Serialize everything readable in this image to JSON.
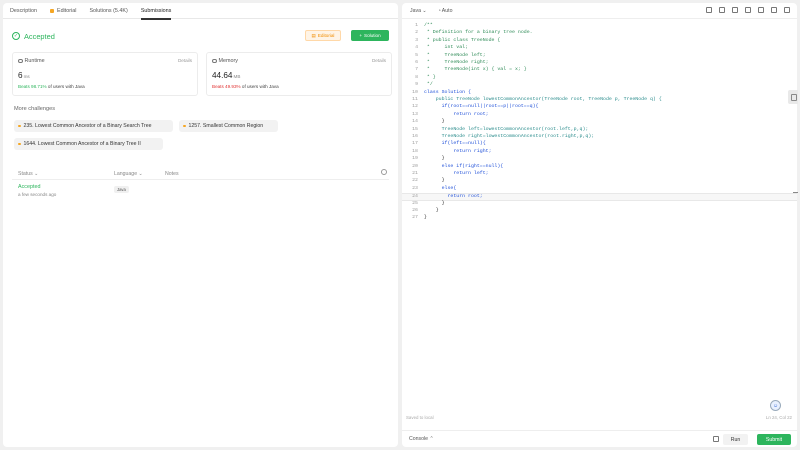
{
  "tabs": [
    {
      "label": "Description"
    },
    {
      "label": "Editorial"
    },
    {
      "label": "Solutions (5.4K)"
    },
    {
      "label": "Submissions"
    }
  ],
  "result": {
    "status": "Accepted",
    "editorial_btn": "Editorial",
    "solution_btn": "Solution"
  },
  "runtime": {
    "label": "Runtime",
    "details": "Details",
    "value": "6",
    "unit": "ms",
    "beats_pct": "Beats 98.71%",
    "beats_suffix": "of users with Java"
  },
  "memory": {
    "label": "Memory",
    "details": "Details",
    "value": "44.64",
    "unit": "MB",
    "beats_pct": "Beats 49.93%",
    "beats_suffix": "of users with Java"
  },
  "more": {
    "title": "More challenges",
    "items": [
      {
        "label": "235. Lowest Common Ancestor of a Binary Search Tree"
      },
      {
        "label": "1257. Smallest Common Region"
      },
      {
        "label": "1644. Lowest Common Ancestor of a Binary Tree II"
      }
    ]
  },
  "submissions": {
    "col_status": "Status",
    "col_language": "Language",
    "col_notes": "Notes",
    "row": {
      "status": "Accepted",
      "time": "a few seconds ago",
      "language": "Java"
    }
  },
  "editor": {
    "language": "Java",
    "mode": "Auto",
    "saved": "Saved to local",
    "cursor": "Ln 24, Col 22",
    "console": "Console",
    "run": "Run",
    "submit": "Submit",
    "lines": [
      {
        "n": "1",
        "text": "/**",
        "cls": "c-comment"
      },
      {
        "n": "2",
        "text": " * Definition for a binary tree node.",
        "cls": "c-comment"
      },
      {
        "n": "3",
        "text": " * public class TreeNode {",
        "cls": "c-comment"
      },
      {
        "n": "4",
        "text": " *     int val;",
        "cls": "c-comment"
      },
      {
        "n": "5",
        "text": " *     TreeNode left;",
        "cls": "c-comment"
      },
      {
        "n": "6",
        "text": " *     TreeNode right;",
        "cls": "c-comment"
      },
      {
        "n": "7",
        "text": " *     TreeNode(int x) { val = x; }",
        "cls": "c-comment"
      },
      {
        "n": "8",
        "text": " * }",
        "cls": "c-comment"
      },
      {
        "n": "9",
        "text": " */",
        "cls": "c-comment"
      },
      {
        "n": "10",
        "text": "class Solution {",
        "cls": "c-kw"
      },
      {
        "n": "11",
        "text": "    public TreeNode lowestCommonAncestor(TreeNode root, TreeNode p, TreeNode q) {",
        "cls": "c-type"
      },
      {
        "n": "12",
        "text": "      if(root==null||root==p||root==q){",
        "cls": "c-kw"
      },
      {
        "n": "13",
        "text": "          return root;",
        "cls": "c-kw"
      },
      {
        "n": "14",
        "text": "      }",
        "cls": "c-plain"
      },
      {
        "n": "15",
        "text": "      TreeNode left=lowestCommonAncestor(root.left,p,q);",
        "cls": "c-type"
      },
      {
        "n": "16",
        "text": "      TreeNode right=lowestCommonAncestor(root.right,p,q);",
        "cls": "c-type"
      },
      {
        "n": "17",
        "text": "      if(left==null){",
        "cls": "c-kw"
      },
      {
        "n": "18",
        "text": "          return right;",
        "cls": "c-kw"
      },
      {
        "n": "19",
        "text": "      }",
        "cls": "c-plain"
      },
      {
        "n": "20",
        "text": "      else if(right==null){",
        "cls": "c-kw"
      },
      {
        "n": "21",
        "text": "          return left;",
        "cls": "c-kw"
      },
      {
        "n": "22",
        "text": "      }",
        "cls": "c-plain"
      },
      {
        "n": "23",
        "text": "      else{",
        "cls": "c-kw"
      },
      {
        "n": "24",
        "text": "        return root;",
        "cls": "c-kw"
      },
      {
        "n": "25",
        "text": "      }",
        "cls": "c-plain"
      },
      {
        "n": "26",
        "text": "    }",
        "cls": "c-plain"
      },
      {
        "n": "27",
        "text": "}",
        "cls": "c-plain"
      }
    ]
  },
  "colors": {
    "accent_green": "#2db55d",
    "editorial_orange": "#f08c00",
    "beats_red": "#e03131"
  }
}
